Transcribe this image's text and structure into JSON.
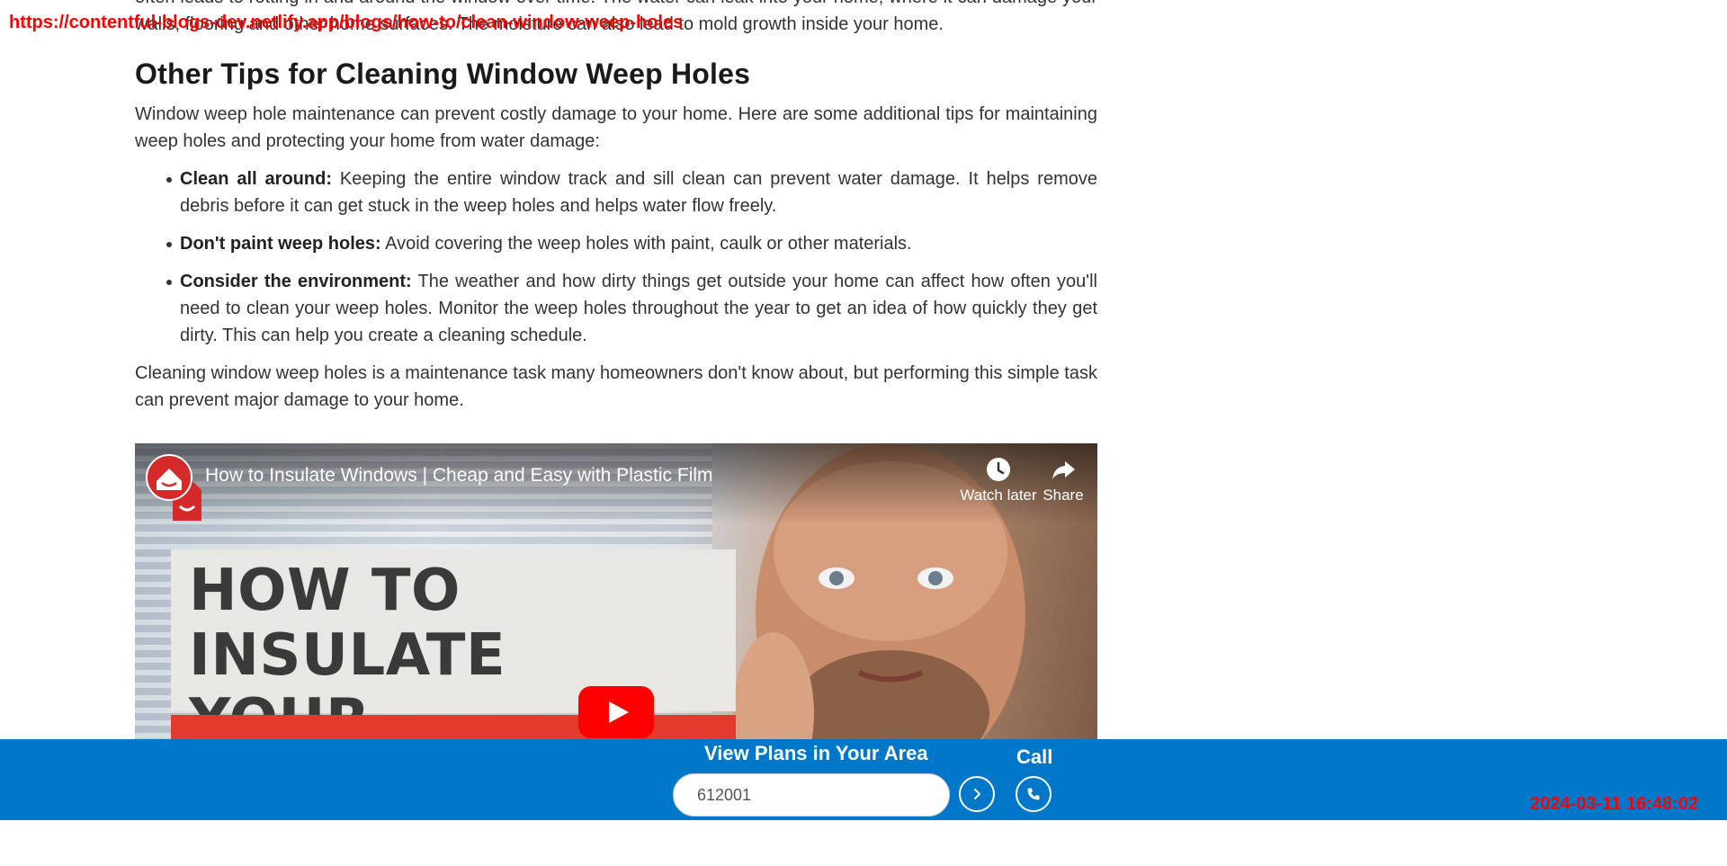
{
  "overlay": {
    "url": "https://contentful-blogs-dev.netlify.app/blogs/how-to/clean-window-weep-holes",
    "timestamp": "2024-03-11 16:48:02"
  },
  "article": {
    "intro_fragment": "often leads to rotting in and around the window over time. The water can leak into your home, where it can damage your walls, flooring and other home surfaces. The moisture can also lead to mold growth inside your home.",
    "heading": "Other Tips for Cleaning Window Weep Holes",
    "paragraph1": "Window weep hole maintenance can prevent costly damage to your home. Here are some additional tips for maintaining weep holes and protecting your home from water damage:",
    "tips": [
      {
        "title": "Clean all around:",
        "text": " Keeping the entire window track and sill clean can prevent water damage. It helps remove debris before it can get stuck in the weep holes and helps water flow freely."
      },
      {
        "title": "Don't paint weep holes:",
        "text": " Avoid covering the weep holes with paint, caulk or other materials."
      },
      {
        "title": "Consider the environment:",
        "text": " The weather and how dirty things get outside your home can affect how often you'll need to clean your weep holes. Monitor the weep holes throughout the year to get an idea of how quickly they get dirty. This can help you create a cleaning schedule."
      }
    ],
    "paragraph2": "Cleaning window weep holes is a maintenance task many homeowners don't know about, but performing this simple task can prevent major damage to your home."
  },
  "video": {
    "title": "How to Insulate Windows | Cheap and Easy with Plastic Film",
    "thumbnail_text": "HOW TO INSULATE\nYOUR WINDOWS",
    "watch_later_label": "Watch later",
    "share_label": "Share"
  },
  "plan_bar": {
    "title": "View Plans in Your Area",
    "zip_value": "612001",
    "call_label": "Call",
    "background_color": "#0077c8"
  }
}
